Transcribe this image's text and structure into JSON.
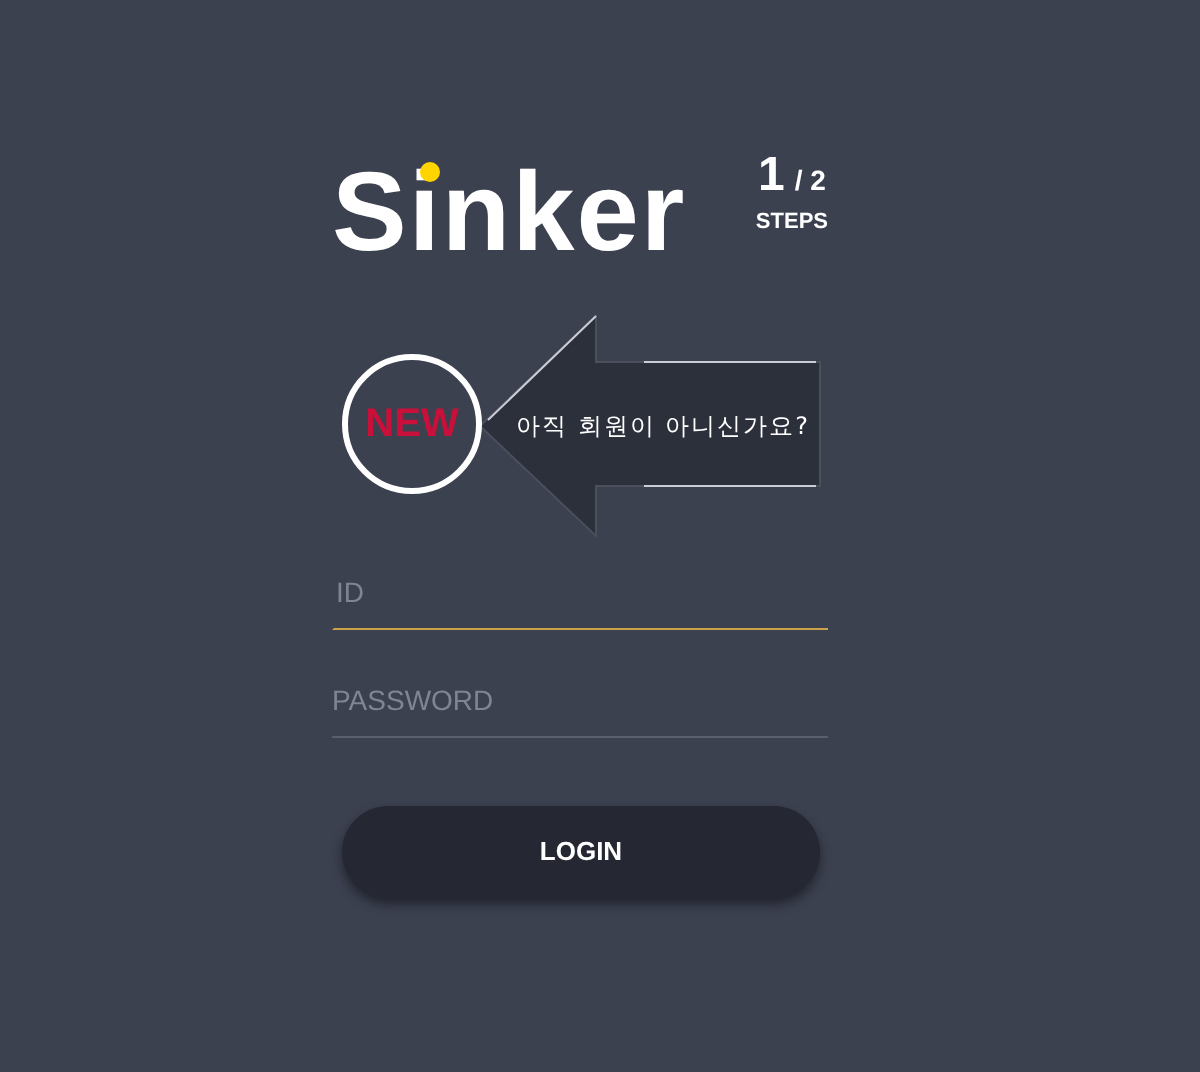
{
  "logo": {
    "text": "Sinker"
  },
  "steps": {
    "current": "1",
    "total": "/ 2",
    "label": "STEPS"
  },
  "signup_banner": {
    "badge": "NEW",
    "text": "아직 회원이 아니신가요?"
  },
  "fields": [
    {
      "placeholder": "ID",
      "focused": true
    },
    {
      "placeholder": "PASSWORD",
      "focused": false
    }
  ],
  "buttons": [
    "LOGIN"
  ]
}
